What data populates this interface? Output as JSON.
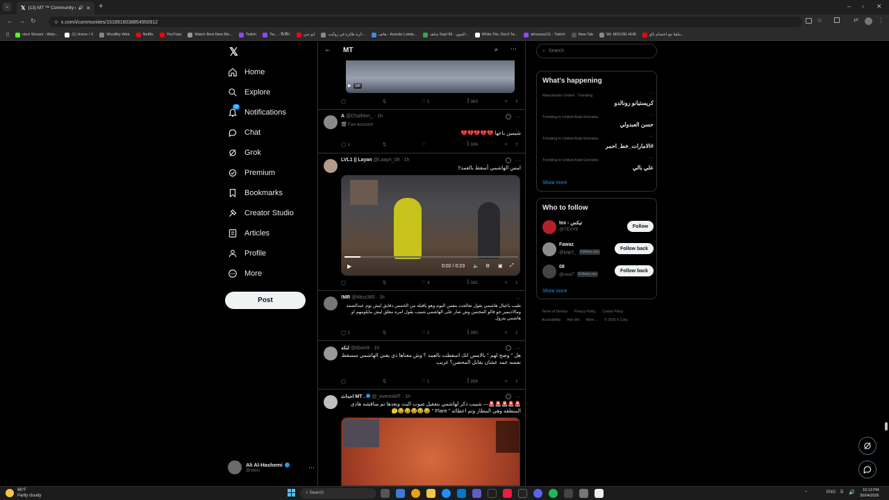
{
  "browser": {
    "tab_title": "(13) MT ™ Community / X",
    "url": "x.com/i/communities/1518916038854950912",
    "bookmarks": [
      {
        "label": "xtexi Stream - Watc...",
        "color": "#53fc18"
      },
      {
        "label": "(1) Home / X",
        "color": "#ffffff"
      },
      {
        "label": "Woolility Web",
        "color": "#888888"
      },
      {
        "label": "Netflix",
        "color": "#e50914"
      },
      {
        "label": "YouTube",
        "color": "#ff0000"
      },
      {
        "label": "Watch Best New Mo...",
        "color": "#999999"
      },
      {
        "label": "Twitch",
        "color": "#9146ff"
      },
      {
        "label": "Tw... - ฝึกฝืก",
        "color": "#9146ff"
      },
      {
        "label": "ابو جبن",
        "color": "#e50914"
      },
      {
        "label": "كرة طائرة في روكيت...",
        "color": "#888888"
      },
      {
        "label": "هاتف - Aranda Lokda...",
        "color": "#4285f4"
      },
      {
        "label": "شاهد Sayf 96 - الموي...",
        "color": "#34a853"
      },
      {
        "label": "White Tile, Don't Ta...",
        "color": "#ffffff"
      },
      {
        "label": "almousa111 - Twitch",
        "color": "#9146ff"
      },
      {
        "label": "New Tab",
        "color": "#555555"
      },
      {
        "label": "WL MOUSE HUB",
        "color": "#888888"
      },
      {
        "label": "ماهيا مع اعتصام بالو...",
        "color": "#e50914"
      }
    ]
  },
  "nav": {
    "items": [
      {
        "label": "Home",
        "icon": "home-icon"
      },
      {
        "label": "Explore",
        "icon": "search-icon"
      },
      {
        "label": "Notifications",
        "icon": "bell-icon",
        "badge": "13"
      },
      {
        "label": "Chat",
        "icon": "chat-icon"
      },
      {
        "label": "Grok",
        "icon": "grok-icon"
      },
      {
        "label": "Premium",
        "icon": "premium-icon"
      },
      {
        "label": "Bookmarks",
        "icon": "bookmark-icon"
      },
      {
        "label": "Creator Studio",
        "icon": "creator-studio-icon"
      },
      {
        "label": "Articles",
        "icon": "articles-icon"
      },
      {
        "label": "Profile",
        "icon": "profile-icon"
      },
      {
        "label": "More",
        "icon": "more-icon"
      }
    ],
    "post_label": "Post",
    "account": {
      "name": "Ali Al-Hashemi",
      "handle": "@xtexi"
    }
  },
  "main": {
    "title": "MT",
    "gif_badge": "GIF",
    "tweets": [
      {
        "id": "t0",
        "actions": {
          "replies": "",
          "retweets": "",
          "likes": "1",
          "views": "363"
        }
      },
      {
        "id": "t1",
        "name": "A",
        "handle": "@ChalMon_ · 1h",
        "sub": "Fan account",
        "body": "شيمين باعها 💔💔💔💔💔",
        "actions": {
          "replies": "1",
          "retweets": "",
          "likes": "",
          "views": "306"
        }
      },
      {
        "id": "t2",
        "name": "LVL1 || Layan",
        "handle": "@Laayn_09 · 1h",
        "body": "امس الهاشمي أسقط بالعمد!!",
        "video_time": "0:02 / 0:23",
        "actions": {
          "replies": "",
          "retweets": "",
          "likes": "4",
          "views": "392"
        }
      },
      {
        "id": "t3",
        "name": "!MR",
        "handle": "@Mtzz385 · 1h",
        "body": "طيب ياعيال هاشمي يقول تعالجت بنفس اليوم وهو ياقبله من الخمس دقايق ليش يوم عبدالصمد ومالاديمير جو قالو المجنس وش صار على الهاشمي شبيب يقول امره معلق ليش مايلومهم او هاشمي يتزول",
        "actions": {
          "replies": "1",
          "retweets": "",
          "likes": "1",
          "views": "390"
        }
      },
      {
        "id": "t4",
        "name": "لنكه",
        "handle": "@tibwn9 · 1h",
        "body": "هل \" وضح لهم \" بالامس انك اسقطت بالعمد ؟ وش معناها ذي يعني الهاشمي سسقط نفسه عمد عشان يقابل المحصن؟ غريب",
        "actions": {
          "replies": "",
          "retweets": "",
          "likes": "1",
          "views": "358"
        }
      },
      {
        "id": "t5",
        "name": "احداث MT .",
        "handle": "@_eventsMT · 1h",
        "body": "🚨🚨🚨🚨🚨— شبيب ذكر لهاشمي بتفقيل صوت البث وبعدها تم مناقشه هاذي المنطقه وهي المطار وتم اعطائه \" Flare \" 😂😂😂😂😂🤔"
      }
    ]
  },
  "right": {
    "search_placeholder": "Search",
    "whats_happening": {
      "title": "What's happening",
      "trends": [
        {
          "context": "Manchester United · Trending",
          "name": "كريستيانو رونالدو"
        },
        {
          "context": "Trending in United Arab Emirates",
          "name": "حسن العبدولي"
        },
        {
          "context": "Trending in United Arab Emirates",
          "name": "#الامارات_خط_احمر"
        },
        {
          "context": "Trending in United Arab Emirates",
          "name": "علي بالي"
        }
      ],
      "show_more": "Show more"
    },
    "who_to_follow": {
      "title": "Who to follow",
      "accounts": [
        {
          "name": "tex - تيكس",
          "handle": "@TEXY9",
          "follows_you": "",
          "button": "Follow"
        },
        {
          "name": "Fawaz",
          "handle": "@pqp2_",
          "follows_you": "Follows you",
          "button": "Follow back"
        },
        {
          "name": "08",
          "handle": "@sxai7",
          "follows_you": "Follows you",
          "button": "Follow back"
        }
      ],
      "show_more": "Show more"
    },
    "footer": [
      "Terms of Service",
      "Privacy Policy",
      "Cookie Policy",
      "Accessibility",
      "Ads info",
      "More ...",
      "© 2026 X Corp."
    ]
  },
  "taskbar": {
    "weather_temp": "86°F",
    "weather_desc": "Partly cloudy",
    "search_placeholder": "Search",
    "lang": "ENG",
    "time": "10:13 PM",
    "date": "30/04/2026"
  }
}
